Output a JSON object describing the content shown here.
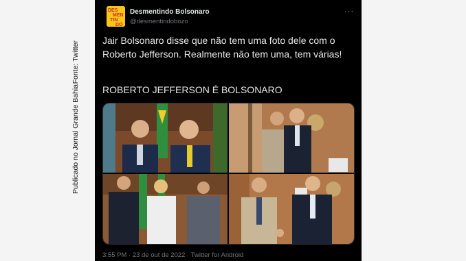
{
  "colors": {
    "background": "#000000",
    "text_primary": "#e7e9ea",
    "text_secondary": "#71767b",
    "side_band": "#f4f4f4",
    "avatar_yellow": "#f7c51b",
    "avatar_red": "#d62b1f"
  },
  "credit": {
    "line1": "Fonte: Twitter",
    "line2": "Publicado no Jornal Grande Bahia"
  },
  "tweet": {
    "avatar_icon": "logo-avatar-icon",
    "avatar_text": [
      "DES",
      "MEN",
      "TIN",
      "DO"
    ],
    "author_name": "Desmentindo Bolsonaro",
    "author_handle": "@desmentindobozo",
    "more_icon": "more-options-icon",
    "more_glyph": "···",
    "text": "Jair Bolsonaro disse que não tem uma foto dele com o Roberto Jefferson. Realmente não tem uma, tem várias!",
    "headline": "ROBERTO JEFFERSON É BOLSONARO",
    "meta": "3:55 PM · 23 de out de 2022 · Twitter for Android"
  }
}
